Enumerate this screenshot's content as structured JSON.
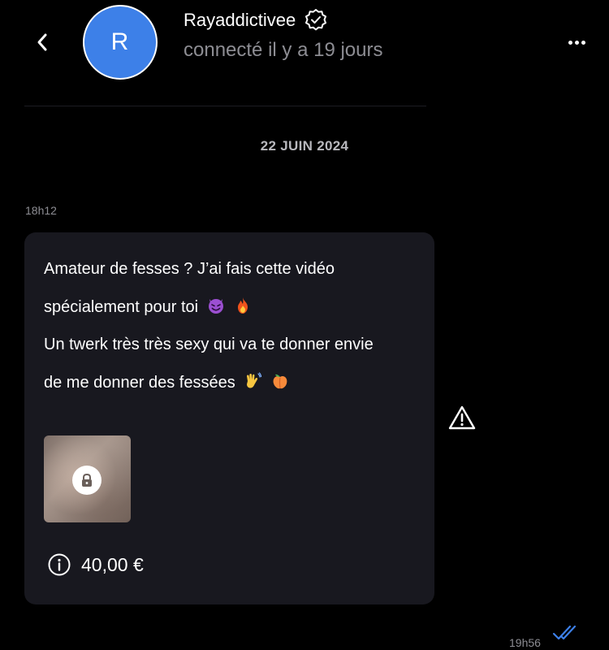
{
  "header": {
    "avatar_letter": "R",
    "name": "Rayaddictivee",
    "status": "connecté il y a 19 jours"
  },
  "conversation": {
    "date_separator": "22 JUIN 2024",
    "incoming_time": "18h12",
    "message": {
      "line1": "Amateur de fesses ? J’ai fais cette vidéo",
      "line2": "spécialement pour toi",
      "line3": "Un twerk très très sexy qui va te donner envie",
      "line4": "de me donner des fessées",
      "emojis_line2": [
        "smiling-devil-emoji",
        "fire-emoji"
      ],
      "emojis_line4": [
        "waving-hand-emoji",
        "peach-emoji"
      ]
    },
    "locked_media": {
      "icon": "lock-icon"
    },
    "price": "40,00 €",
    "outgoing_time": "19h56"
  },
  "icons": {
    "back": "chevron-left-icon",
    "verified": "verified-badge-icon",
    "more": "more-horizontal-icon",
    "info": "info-icon",
    "warning": "warning-triangle-icon",
    "read": "double-check-icon"
  },
  "colors": {
    "background": "#000000",
    "avatar": "#3d80e8",
    "bubble": "#18181f",
    "muted_text": "#8d8d93",
    "read_check": "#3d80e8"
  }
}
